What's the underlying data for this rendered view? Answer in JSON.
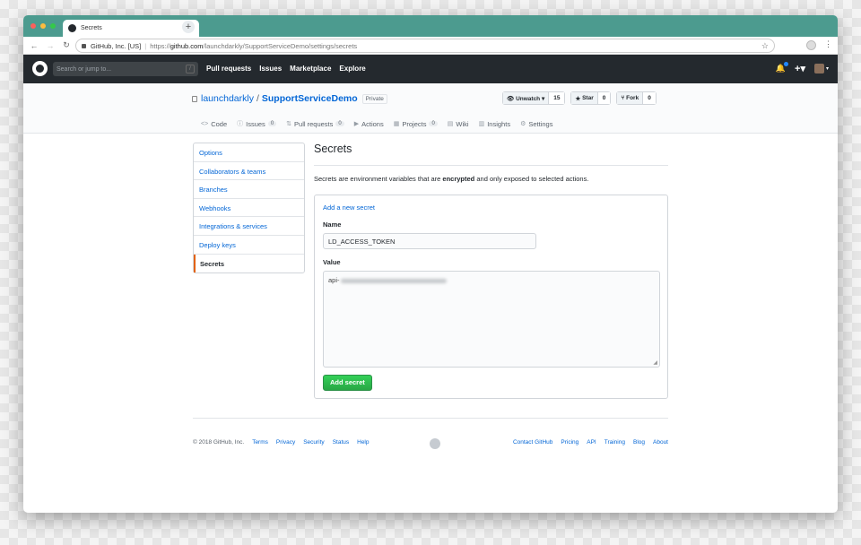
{
  "browser": {
    "tab_title": "Secrets",
    "tab_close": "×",
    "new_tab": "+",
    "org_badge": "GitHub, Inc. [US]",
    "url_scheme": "https://",
    "url_host": "github.com",
    "url_path": "/launchdarkly/SupportServiceDemo/settings/secrets",
    "back": "←",
    "forward": "→",
    "reload": "↻",
    "bookmark": "☆",
    "menu": "⋮",
    "traffic_colors": [
      "#fc605c",
      "#fdbc40",
      "#34c84a"
    ]
  },
  "gh_header": {
    "search_placeholder": "Search or jump to...",
    "search_key": "/",
    "nav": [
      "Pull requests",
      "Issues",
      "Marketplace",
      "Explore"
    ],
    "plus": "+▾",
    "caret": "▾"
  },
  "repo": {
    "owner": "launchdarkly",
    "separator": "/",
    "name": "SupportServiceDemo",
    "badge": "Private",
    "watch_label": "Unwatch ▾",
    "watch_count": "15",
    "star_label": "Star",
    "star_count": "0",
    "fork_label": "Fork",
    "fork_count": "0",
    "tabs": [
      {
        "icon": "<>",
        "label": "Code",
        "count": ""
      },
      {
        "icon": "ⓘ",
        "label": "Issues",
        "count": "0"
      },
      {
        "icon": "⇅",
        "label": "Pull requests",
        "count": "0"
      },
      {
        "icon": "▶",
        "label": "Actions",
        "count": ""
      },
      {
        "icon": "▦",
        "label": "Projects",
        "count": "0"
      },
      {
        "icon": "▤",
        "label": "Wiki",
        "count": ""
      },
      {
        "icon": "▥",
        "label": "Insights",
        "count": ""
      },
      {
        "icon": "⚙",
        "label": "Settings",
        "count": ""
      }
    ]
  },
  "settings_menu": [
    "Options",
    "Collaborators & teams",
    "Branches",
    "Webhooks",
    "Integrations & services",
    "Deploy keys",
    "Secrets"
  ],
  "secrets": {
    "title": "Secrets",
    "desc_before": "Secrets are environment variables that are ",
    "desc_strong": "encrypted",
    "desc_after": " and only exposed to selected actions.",
    "add_link": "Add a new secret",
    "name_label": "Name",
    "name_value": "LD_ACCESS_TOKEN",
    "value_label": "Value",
    "value_prefix": "api-",
    "submit": "Add secret"
  },
  "footer": {
    "copyright": "© 2018 GitHub, Inc.",
    "left_links": [
      "Terms",
      "Privacy",
      "Security",
      "Status",
      "Help"
    ],
    "right_links": [
      "Contact GitHub",
      "Pricing",
      "API",
      "Training",
      "Blog",
      "About"
    ]
  }
}
